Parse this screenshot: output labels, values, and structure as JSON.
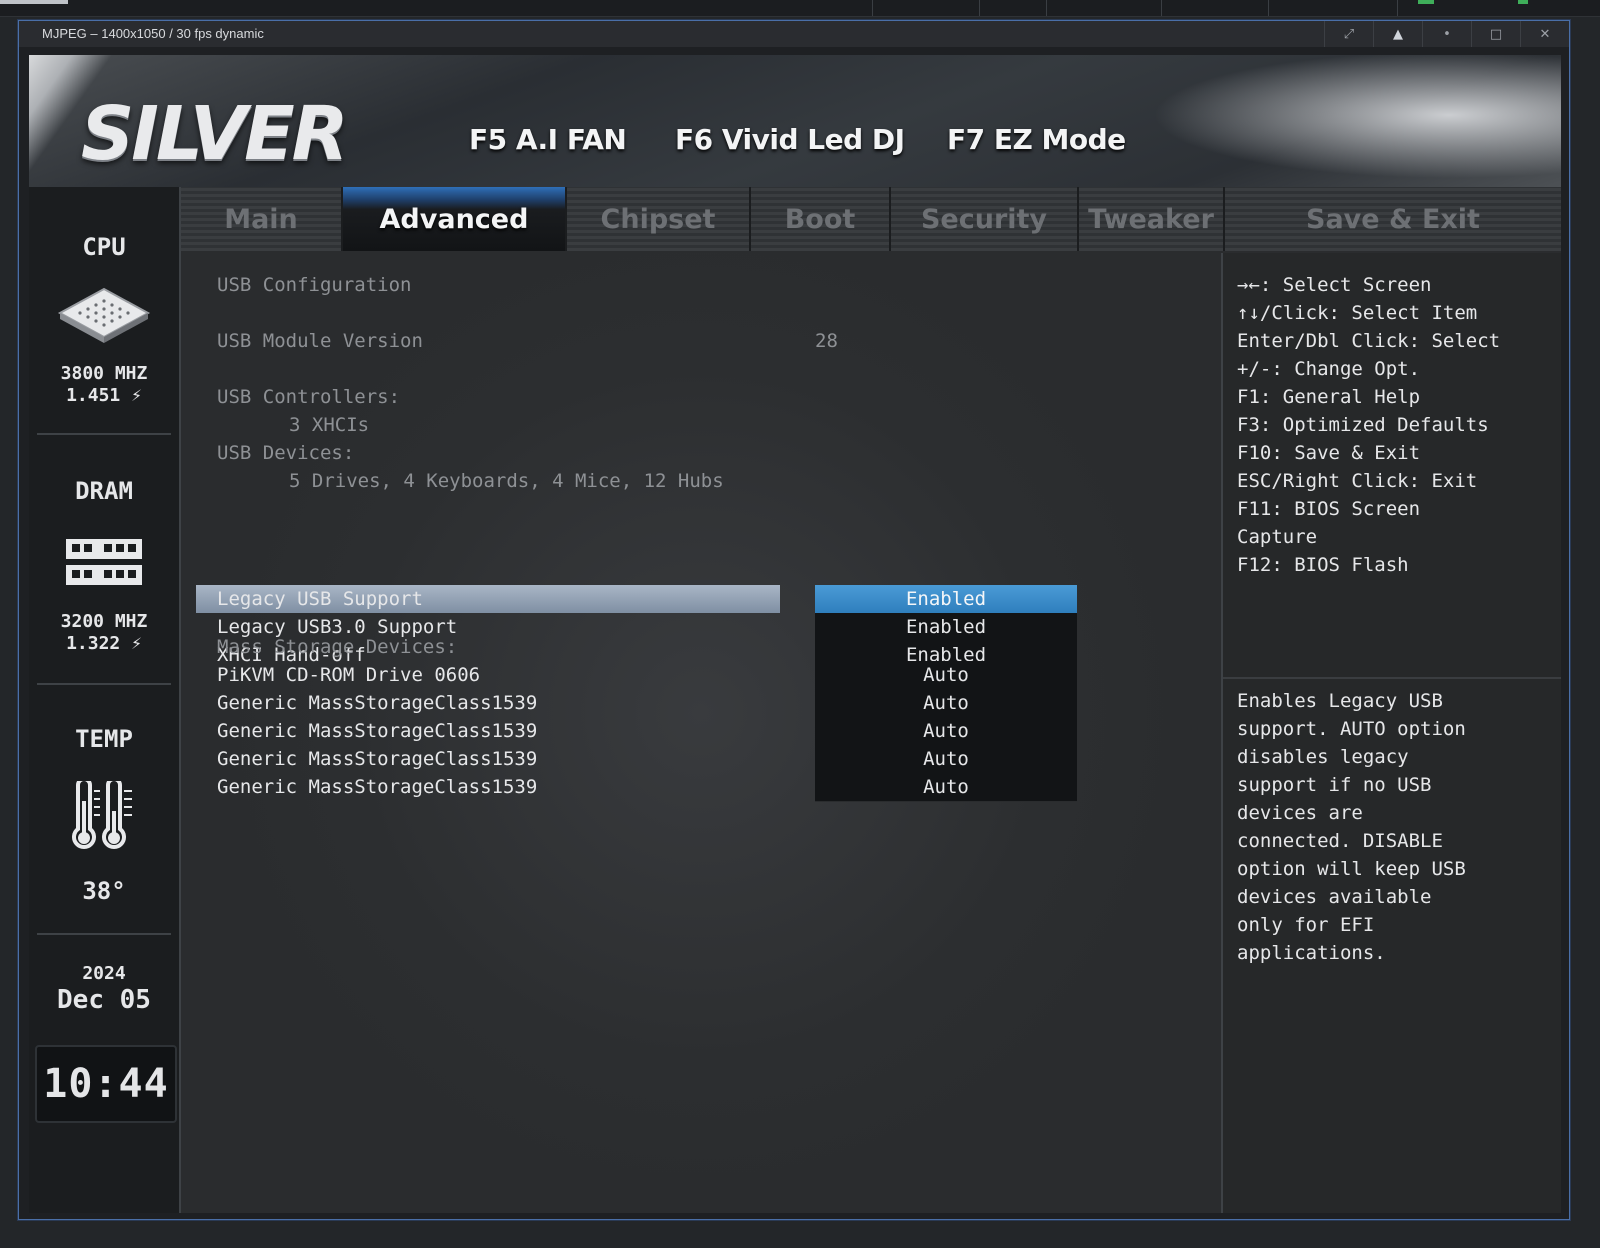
{
  "window": {
    "title": "MJPEG – 1400x1050 / 30 fps dynamic",
    "buttons": [
      "⤢",
      "▲",
      "•",
      "□",
      "✕"
    ]
  },
  "header": {
    "logo": "SILVER",
    "hotkeys": [
      "F5 A.I FAN",
      "F6 Vivid Led DJ",
      "F7 EZ Mode"
    ]
  },
  "rail": {
    "cpu": {
      "label": "CPU",
      "freq": "3800 MHZ",
      "volt": "1.451 ⚡"
    },
    "dram": {
      "label": "DRAM",
      "freq": "3200 MHZ",
      "volt": "1.322 ⚡"
    },
    "temp": {
      "label": "TEMP",
      "value": "38°"
    },
    "date": {
      "year": "2024",
      "day": "Dec 05"
    },
    "clock": "10:44"
  },
  "tabs": [
    {
      "label": "Main",
      "active": false
    },
    {
      "label": "Advanced",
      "active": true
    },
    {
      "label": "Chipset",
      "active": false
    },
    {
      "label": "Boot",
      "active": false
    },
    {
      "label": "Security",
      "active": false
    },
    {
      "label": "Tweaker",
      "active": false
    },
    {
      "label": "Save & Exit",
      "active": false
    }
  ],
  "main": {
    "section_title": "USB Configuration",
    "module_version_label": "USB Module Version",
    "module_version_value": "28",
    "controllers_label": "USB Controllers:",
    "controllers_value": "3 XHCIs",
    "devices_label": "USB Devices:",
    "devices_value": "5 Drives, 4 Keyboards, 4 Mice, 12 Hubs",
    "settings": [
      {
        "label": "Legacy USB Support",
        "value": "Enabled",
        "selected": true
      },
      {
        "label": "Legacy USB3.0 Support",
        "value": "Enabled",
        "selected": false
      },
      {
        "label": "XHCI Hand-off",
        "value": "Enabled",
        "selected": false
      }
    ],
    "mass_storage_label": "Mass Storage Devices:",
    "mass_storage": [
      {
        "label": "PiKVM CD-ROM Drive 0606",
        "value": "Auto"
      },
      {
        "label": "Generic MassStorageClass1539",
        "value": "Auto"
      },
      {
        "label": "Generic MassStorageClass1539",
        "value": "Auto"
      },
      {
        "label": "Generic MassStorageClass1539",
        "value": "Auto"
      },
      {
        "label": "Generic MassStorageClass1539",
        "value": "Auto"
      }
    ]
  },
  "help": {
    "keys": [
      "→←: Select Screen",
      "↑↓/Click: Select Item",
      "Enter/Dbl Click: Select",
      "+/-: Change Opt.",
      "F1: General Help",
      "F3: Optimized Defaults",
      "F10: Save & Exit",
      "ESC/Right Click: Exit",
      "F11: BIOS Screen",
      "Capture",
      "F12: BIOS Flash"
    ],
    "description": [
      "Enables Legacy USB",
      "support. AUTO option",
      "disables legacy",
      "support if no USB",
      "devices are",
      "connected. DISABLE",
      "option will keep USB",
      "devices available",
      "only for EFI",
      "applications."
    ]
  }
}
